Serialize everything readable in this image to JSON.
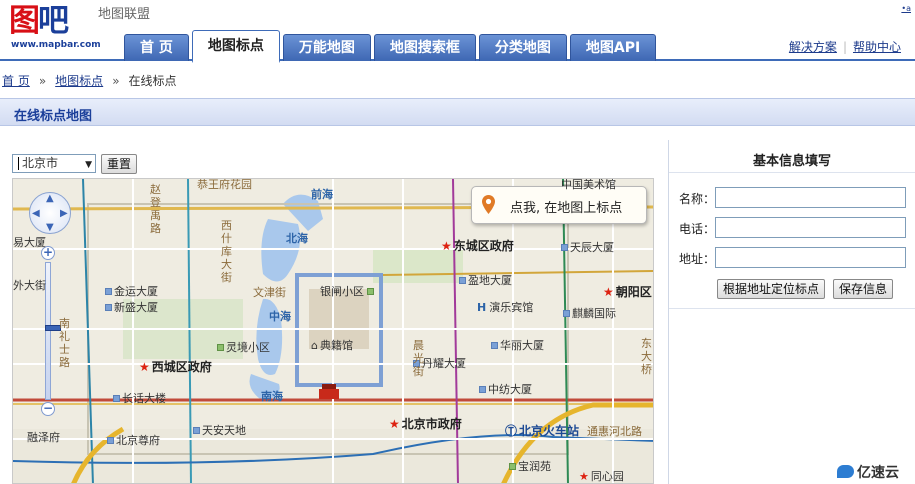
{
  "header": {
    "logo_cn_a": "图",
    "logo_cn_b": "吧",
    "logo_url": "www.mapbar.com",
    "site_sub": "地图联盟",
    "corner_link": "•a",
    "tabs": [
      {
        "label": "首 页"
      },
      {
        "label": "地图标点"
      },
      {
        "label": "万能地图"
      },
      {
        "label": "地图搜索框"
      },
      {
        "label": "分类地图"
      },
      {
        "label": "地图API"
      }
    ],
    "links": {
      "solutions": "解决方案",
      "separator": "|",
      "help": "帮助中心"
    }
  },
  "breadcrumb": {
    "home": "首 页",
    "mark": "地图标点",
    "current": "在线标点",
    "arrow": "»"
  },
  "section": {
    "title": "在线标点地图"
  },
  "controls": {
    "city_value": "北京市",
    "reset_label": "重置"
  },
  "map": {
    "mark_tip": "点我, 在地图上标点",
    "labels": [
      {
        "text": "恭王府花园"
      },
      {
        "text": "前海"
      },
      {
        "text": "中国美术馆"
      },
      {
        "text": "易大厦"
      },
      {
        "text": "赵登禹路"
      },
      {
        "text": "西什库大街"
      },
      {
        "text": "北海"
      },
      {
        "text": "东城区政府"
      },
      {
        "text": "天辰大厦"
      },
      {
        "text": "外大街"
      },
      {
        "text": "金运大厦"
      },
      {
        "text": "新盛大厦"
      },
      {
        "text": "文津街"
      },
      {
        "text": "银闸小区"
      },
      {
        "text": "盈地大厦"
      },
      {
        "text": "朝阳区"
      },
      {
        "text": "演乐宾馆"
      },
      {
        "text": "麒麟国际"
      },
      {
        "text": "中海"
      },
      {
        "text": "灵境小区"
      },
      {
        "text": "典籍馆"
      },
      {
        "text": "华丽大厦"
      },
      {
        "text": "西城区政府"
      },
      {
        "text": "丹耀大厦"
      },
      {
        "text": "南海"
      },
      {
        "text": "中纺大厦"
      },
      {
        "text": "长话大楼"
      },
      {
        "text": "北京市政府"
      },
      {
        "text": "北京火车站"
      },
      {
        "text": "天安天地"
      },
      {
        "text": "北京尊府"
      },
      {
        "text": "融泽府"
      },
      {
        "text": "宝润苑"
      },
      {
        "text": "同心园"
      },
      {
        "text": "南礼士路"
      },
      {
        "text": "晨光街"
      },
      {
        "text": "东大桥"
      },
      {
        "text": "通惠河北路"
      }
    ],
    "zoom_level_fraction": 0.48
  },
  "panel": {
    "title": "基本信息填写",
    "name_label": "名称：",
    "phone_label": "电话：",
    "address_label": "地址：",
    "locate_label": "根据地址定位标点",
    "save_label": "保存信息"
  },
  "watermark": "亿速云"
}
